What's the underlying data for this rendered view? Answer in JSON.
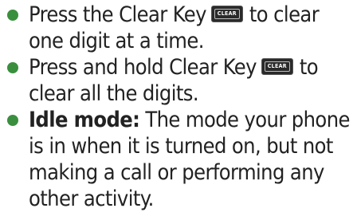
{
  "bullets": [
    {
      "before": "Press the Clear Key",
      "key_label": "CLEAR",
      "after": "to clear one digit at a time."
    },
    {
      "before": "Press and hold Clear Key",
      "key_label": "CLEAR",
      "after": "to clear all the digits."
    },
    {
      "term": "Idle mode:",
      "text": "The mode your phone is in when it is turned on, but not making a call or performing any other activity."
    }
  ],
  "colors": {
    "bullet": "#3a8f3e",
    "text": "#222222"
  }
}
